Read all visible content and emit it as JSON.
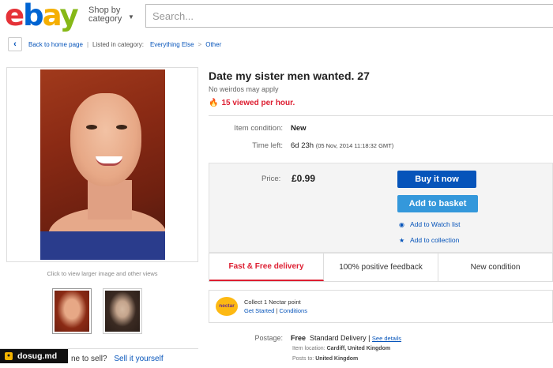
{
  "header": {
    "logo": {
      "e": "e",
      "b": "b",
      "a": "a",
      "y": "y"
    },
    "shop_by_line1": "Shop by",
    "shop_by_line2": "category",
    "search_placeholder": "Search..."
  },
  "breadcrumb": {
    "back": "Back to home page",
    "listed_in": "Listed in category:",
    "cat1": "Everything Else",
    "sep": ">",
    "cat2": "Other"
  },
  "gallery": {
    "caption": "Click to view larger image and other views",
    "sell_prefix": "ne to sell?",
    "sell_link": "Sell it yourself"
  },
  "watermark": "dosug.md",
  "listing": {
    "title": "Date my sister men wanted. 27",
    "subtitle": "No weirdos may apply",
    "hot": "15 viewed per hour.",
    "condition_label": "Item condition:",
    "condition_value": "New",
    "time_label": "Time left:",
    "time_value": "6d 23h",
    "time_detail": "(05 Nov, 2014  11:18:32 GMT)"
  },
  "buy_box": {
    "price_label": "Price:",
    "price_value": "£0.99",
    "buy_now": "Buy it now",
    "add_basket": "Add to basket",
    "watch": "Add to Watch list",
    "collection": "Add to collection"
  },
  "features": [
    "Fast & Free delivery",
    "100% positive feedback",
    "New condition"
  ],
  "nectar": {
    "logo": "nectar",
    "line1": "Collect 1 Nectar point",
    "get_started": "Get Started",
    "sep": "|",
    "conditions": "Conditions"
  },
  "postage": {
    "label": "Postage:",
    "free": "Free",
    "service": "Standard Delivery |",
    "see": "See details",
    "loc_label": "Item location:",
    "loc_value": "Cardiff, United Kingdom",
    "posts_label": "Posts to:",
    "posts_value": "United Kingdom"
  },
  "colors": {
    "ebay_red": "#e53238",
    "ebay_blue": "#0064d2",
    "ebay_yellow": "#f5af02",
    "ebay_green": "#86b817",
    "link": "#0654ba",
    "hot_red": "#dd1e31"
  }
}
